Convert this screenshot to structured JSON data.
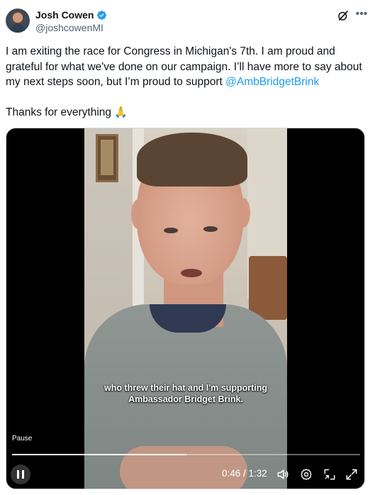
{
  "author": {
    "display_name": "Josh Cowen",
    "handle": "@joshcowenMI",
    "verified": true
  },
  "tweet": {
    "text_before_mention": "I am exiting the race for Congress in Michigan's 7th. I am proud and grateful for what we've done on our campaign. I’ll have more to say about my next steps soon, but I’m proud to support ",
    "mention": "@AmbBridgetBrink",
    "thanks": "Thanks for everything",
    "thanks_emoji": "🙏"
  },
  "video": {
    "caption": "who threw their hat and I'm supporting Ambassador Bridget Brink.",
    "pause_tooltip": "Pause",
    "current_time": "0:46",
    "duration": "1:32",
    "time_display": "0:46 / 1:32",
    "progress": 0.5
  },
  "icons": {
    "header": [
      "grok-icon",
      "more-icon"
    ],
    "controls": [
      "pause-icon",
      "volume-icon",
      "settings-icon",
      "minimize-icon",
      "fullscreen-icon"
    ]
  },
  "colors": {
    "accent": "#1d9bf0",
    "text": "#0f1419",
    "secondary": "#536471"
  }
}
